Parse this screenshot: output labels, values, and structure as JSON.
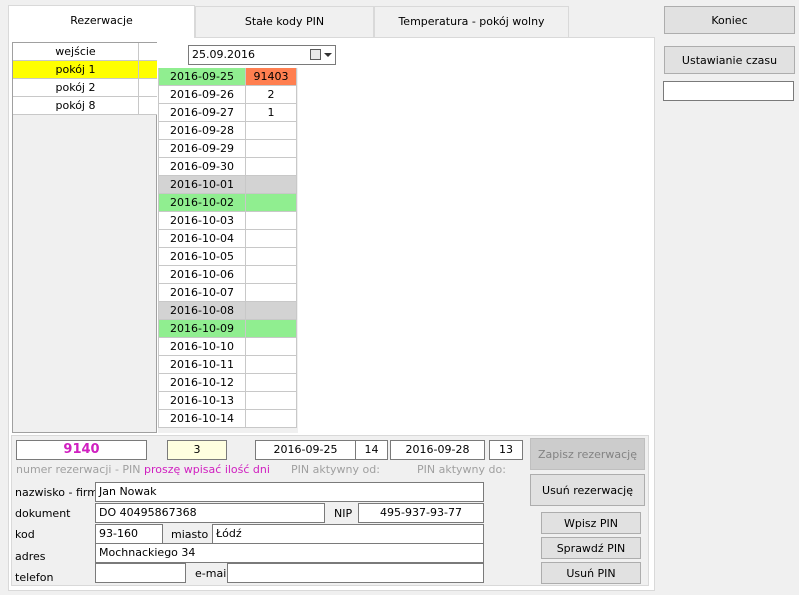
{
  "tabs": [
    {
      "label": "Rezerwacje",
      "active": true
    },
    {
      "label": "Stałe kody PIN",
      "active": false
    },
    {
      "label": "Temperatura - pokój wolny",
      "active": false
    }
  ],
  "side": {
    "end_button": "Koniec",
    "time_button": "Ustawianie czasu",
    "time_field": ""
  },
  "rooms": [
    {
      "name": "wejście",
      "selected": false
    },
    {
      "name": "pokój 1",
      "selected": true
    },
    {
      "name": "pokój 2",
      "selected": false
    },
    {
      "name": "pokój 8",
      "selected": false
    }
  ],
  "date_picker": {
    "value": "25.09.2016"
  },
  "dates": [
    {
      "date": "2016-09-25",
      "value": "91403",
      "state": "first"
    },
    {
      "date": "2016-09-26",
      "value": "2",
      "state": "normal"
    },
    {
      "date": "2016-09-27",
      "value": "1",
      "state": "normal"
    },
    {
      "date": "2016-09-28",
      "value": "",
      "state": "normal"
    },
    {
      "date": "2016-09-29",
      "value": "",
      "state": "normal"
    },
    {
      "date": "2016-09-30",
      "value": "",
      "state": "normal"
    },
    {
      "date": "2016-10-01",
      "value": "",
      "state": "weekend"
    },
    {
      "date": "2016-10-02",
      "value": "",
      "state": "green"
    },
    {
      "date": "2016-10-03",
      "value": "",
      "state": "normal"
    },
    {
      "date": "2016-10-04",
      "value": "",
      "state": "normal"
    },
    {
      "date": "2016-10-05",
      "value": "",
      "state": "normal"
    },
    {
      "date": "2016-10-06",
      "value": "",
      "state": "normal"
    },
    {
      "date": "2016-10-07",
      "value": "",
      "state": "normal"
    },
    {
      "date": "2016-10-08",
      "value": "",
      "state": "weekend"
    },
    {
      "date": "2016-10-09",
      "value": "",
      "state": "green"
    },
    {
      "date": "2016-10-10",
      "value": "",
      "state": "normal"
    },
    {
      "date": "2016-10-11",
      "value": "",
      "state": "normal"
    },
    {
      "date": "2016-10-12",
      "value": "",
      "state": "normal"
    },
    {
      "date": "2016-10-13",
      "value": "",
      "state": "normal"
    },
    {
      "date": "2016-10-14",
      "value": "",
      "state": "normal"
    }
  ],
  "reservation": {
    "pin": "9140",
    "pin_label": "numer rezerwacji - PIN",
    "days": "3",
    "days_label": "proszę wpisać ilość dni",
    "from_date": "2016-09-25",
    "from_hour": "14",
    "from_label": "PIN aktywny od:",
    "to_date": "2016-09-28",
    "to_hour": "13",
    "to_label": "PIN aktywny do:",
    "save_button": "Zapisz rezerwację",
    "delete_button": "Usuń rezerwację"
  },
  "guest": {
    "name_label": "nazwisko - firma",
    "name": "Jan Nowak",
    "doc_label": "dokument",
    "doc": "DO 40495867368",
    "nip_label": "NIP",
    "nip": "495-937-93-77",
    "zip_label": "kod",
    "zip": "93-160",
    "city_label": "miasto",
    "city": "Łódź",
    "address_label": "adres",
    "address": "Mochnackiego 34",
    "phone_label": "telefon",
    "phone": "",
    "email_label": "e-mail",
    "email": ""
  },
  "pin_buttons": {
    "write": "Wpisz PIN",
    "check": "Sprawdź PIN",
    "delete": "Usuń PIN"
  },
  "colors": {
    "pin_text": "#d020c0",
    "selected_room": "#ffff00",
    "weekend": "#d3d3d3",
    "holiday": "#90ee90",
    "reservation_start": "#ff7f50",
    "days_field": "#ffffe0"
  }
}
